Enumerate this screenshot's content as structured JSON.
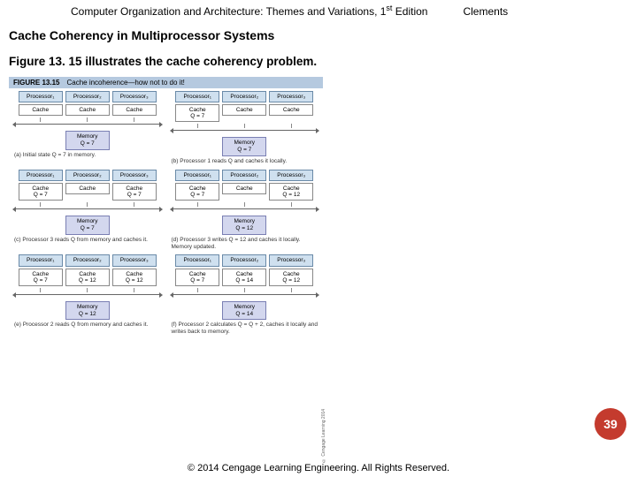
{
  "header": {
    "book_title_prefix": "Computer Organization and Architecture: Themes and Variations, 1",
    "book_title_sup": "st",
    "book_title_suffix": " Edition",
    "author": "Clements"
  },
  "section_title": "Cache Coherency in Multiprocessor Systems",
  "caption": "Figure 13. 15 illustrates the cache coherency problem.",
  "figure": {
    "label_num": "FIGURE 13.15",
    "label_desc": "Cache incoherence—how not to do it!",
    "panels": [
      {
        "procs": [
          "Processor₁",
          "Processor₂",
          "Processor₃"
        ],
        "caches": [
          "Cache",
          "Cache",
          "Cache"
        ],
        "memory": "Memory\nQ = 7",
        "caption": "(a) Initial state Q = 7 in memory."
      },
      {
        "procs": [
          "Processor₁",
          "Processor₂",
          "Processor₃"
        ],
        "caches": [
          "Cache\nQ = 7",
          "Cache",
          "Cache"
        ],
        "memory": "Memory\nQ = 7",
        "caption": "(b) Processor 1 reads Q and caches it locally."
      },
      {
        "procs": [
          "Processor₁",
          "Processor₂",
          "Processor₃"
        ],
        "caches": [
          "Cache\nQ = 7",
          "Cache",
          "Cache\nQ = 7"
        ],
        "memory": "Memory\nQ = 7",
        "caption": "(c) Processor 3 reads Q from memory and caches it."
      },
      {
        "procs": [
          "Processor₁",
          "Processor₂",
          "Processor₃"
        ],
        "caches": [
          "Cache\nQ = 7",
          "Cache",
          "Cache\nQ = 12"
        ],
        "memory": "Memory\nQ = 12",
        "caption": "(d) Processor 3 writes Q = 12 and caches it locally. Memory updated."
      },
      {
        "procs": [
          "Processor₁",
          "Processor₂",
          "Processor₃"
        ],
        "caches": [
          "Cache\nQ = 7",
          "Cache\nQ = 12",
          "Cache\nQ = 12"
        ],
        "memory": "Memory\nQ = 12",
        "caption": "(e) Processor 2 reads Q from memory and caches it."
      },
      {
        "procs": [
          "Processor₁",
          "Processor₂",
          "Processor₃"
        ],
        "caches": [
          "Cache\nQ = 7",
          "Cache\nQ = 14",
          "Cache\nQ = 12"
        ],
        "memory": "Memory\nQ = 14",
        "caption": "(f) Processor 2 calculates Q = Q + 2, caches it locally and writes back to memory."
      }
    ]
  },
  "vertical_credit": "© Cengage Learning 2014",
  "copyright": "© 2014 Cengage Learning Engineering. All Rights Reserved.",
  "page_number": "39"
}
